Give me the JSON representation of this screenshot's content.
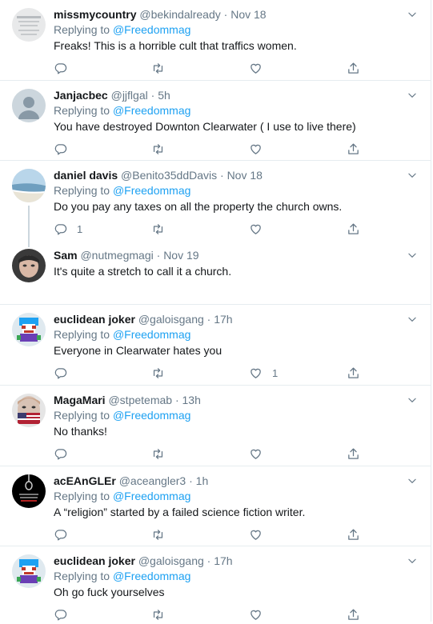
{
  "tweets": [
    {
      "name": "missmycountry",
      "handle": "@bekindalready",
      "time": "Nov 18",
      "replying_label": "Replying to",
      "replying_to": "@Freedommag",
      "text": "Freaks! This is a horrible cult that traffics women.",
      "reply_count": "",
      "like_count": ""
    },
    {
      "name": "Janjacbec",
      "handle": "@jjflgal",
      "time": "5h",
      "replying_label": "Replying to",
      "replying_to": "@Freedommag",
      "text": "You have destroyed Downton Clearwater ( I use to live there)",
      "reply_count": "",
      "like_count": ""
    },
    {
      "name": "daniel davis",
      "handle": "@Benito35ddDavis",
      "time": "Nov 18",
      "replying_label": "Replying to",
      "replying_to": "@Freedommag",
      "text": "Do you pay any taxes on all the property the church owns.",
      "reply_count": "1",
      "like_count": ""
    },
    {
      "name": "Sam",
      "handle": "@nutmegmagi",
      "time": "Nov 19",
      "replying_label": "",
      "replying_to": "",
      "text": "It's quite a stretch to call it a church.",
      "reply_count": "",
      "like_count": ""
    },
    {
      "name": "euclidean joker",
      "handle": "@galoisgang",
      "time": "17h",
      "replying_label": "Replying to",
      "replying_to": "@Freedommag",
      "text": "Everyone in Clearwater hates you",
      "reply_count": "",
      "like_count": "1"
    },
    {
      "name": "MagaMari",
      "handle": "@stpetemab",
      "time": "13h",
      "replying_label": "Replying to",
      "replying_to": "@Freedommag",
      "text": "No thanks!",
      "reply_count": "",
      "like_count": ""
    },
    {
      "name": "acEAnGLEr",
      "handle": "@aceangler3",
      "time": "1h",
      "replying_label": "Replying to",
      "replying_to": "@Freedommag",
      "text": "A “religion” started by a failed science fiction writer.",
      "reply_count": "",
      "like_count": ""
    },
    {
      "name": "euclidean joker",
      "handle": "@galoisgang",
      "time": "17h",
      "replying_label": "Replying to",
      "replying_to": "@Freedommag",
      "text": "Oh go fuck yourselves",
      "reply_count": "",
      "like_count": ""
    }
  ],
  "header_separator": "·",
  "icons": {
    "reply": "reply-icon",
    "retweet": "retweet-icon",
    "like": "like-icon",
    "share": "share-icon",
    "more": "chevron-down-icon"
  },
  "colors": {
    "link": "#1da1f2",
    "secondary": "#657786",
    "border": "#e6ecf0"
  }
}
